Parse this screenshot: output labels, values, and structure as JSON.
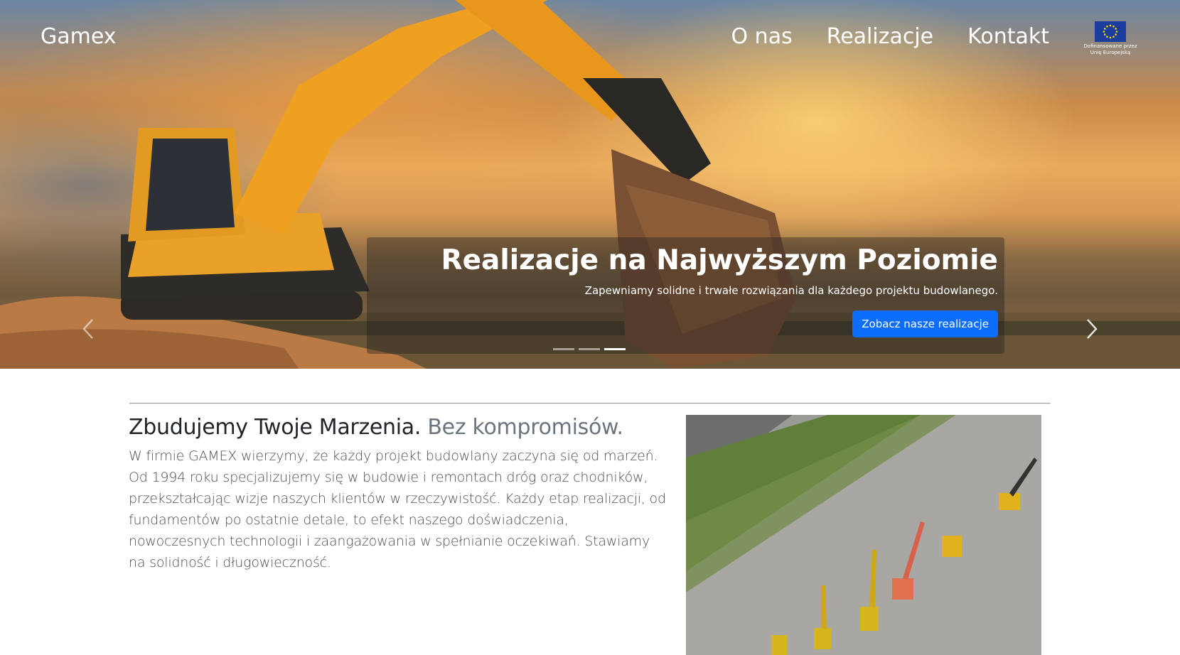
{
  "navbar": {
    "brand": "Gamex",
    "links": [
      "O nas",
      "Realizacje",
      "Kontakt"
    ],
    "eu_badge": {
      "line1": "Dofinansowane przez",
      "line2": "Unię Europejską",
      "flag_color": "#1a3d9e"
    }
  },
  "carousel": {
    "caption_title": "Realizacje na Najwyższym Poziomie",
    "caption_text": "Zapewniamy solidne i trwałe rozwiązania dla każdego projektu budowlanego.",
    "cta_label": "Zobacz nasze realizacje",
    "indicator_count": 3,
    "active_indicator": 3,
    "prev_icon": "chevron-left-icon",
    "next_icon": "chevron-right-icon"
  },
  "feature": {
    "heading": "Zbudujemy Twoje Marzenia.",
    "heading_muted": "Bez kompromisów.",
    "text": "W firmie GAMEX wierzymy, że każdy projekt budowlany zaczyna się od marzeń. Od 1994 roku specjalizujemy się w budowie i remontach dróg oraz chodników, przekształcając wizje naszych klientów w rzeczywistość. Każdy etap realizacji, od fundamentów po ostatnie detale, to efekt naszego doświadczenia, nowoczesnych technologii i zaangażowania w spełnianie oczekiwań. Stawiamy na solidność i długowieczność."
  },
  "colors": {
    "primary": "#0d6efd",
    "muted_text": "#6c757d",
    "excavator": "#f0a020"
  }
}
